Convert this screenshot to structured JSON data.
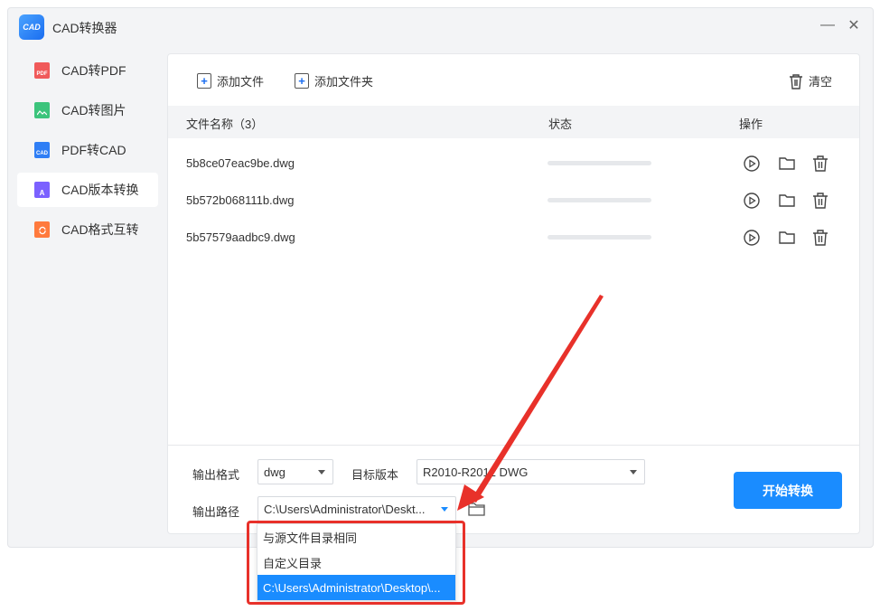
{
  "app": {
    "title": "CAD转换器",
    "logo_text": "CAD"
  },
  "window_controls": {
    "minimize": "—",
    "close": "✕"
  },
  "sidebar": {
    "items": [
      {
        "label": "CAD转PDF",
        "icon": "pdf-file-icon",
        "color": "#f05a5a",
        "tag": "PDF",
        "active": false
      },
      {
        "label": "CAD转图片",
        "icon": "image-file-icon",
        "color": "#3cc47c",
        "tag": "",
        "active": false
      },
      {
        "label": "PDF转CAD",
        "icon": "cad-file-icon",
        "color": "#2f7ef5",
        "tag": "CAD",
        "active": false
      },
      {
        "label": "CAD版本转换",
        "icon": "version-file-icon",
        "color": "#7b61ff",
        "tag": "A",
        "active": true
      },
      {
        "label": "CAD格式互转",
        "icon": "format-convert-icon",
        "color": "#ff7a3d",
        "tag": "",
        "active": false
      }
    ]
  },
  "toolbar": {
    "add_file": "添加文件",
    "add_folder": "添加文件夹",
    "clear": "清空"
  },
  "table": {
    "headers": {
      "name": "文件名称（3）",
      "status": "状态",
      "actions": "操作"
    },
    "rows": [
      {
        "name": "5b8ce07eac9be.dwg",
        "progress": 0
      },
      {
        "name": "5b572b068111b.dwg",
        "progress": 0
      },
      {
        "name": "5b57579aadbc9.dwg",
        "progress": 0
      }
    ]
  },
  "settings": {
    "format_label": "输出格式",
    "format_value": "dwg",
    "version_label": "目标版本",
    "version_value": "R2010-R2012 DWG",
    "path_label": "输出路径",
    "path_value": "C:\\Users\\Administrator\\Deskt..."
  },
  "start_button": "开始转换",
  "path_dropdown": {
    "options": [
      {
        "label": "与源文件目录相同",
        "selected": false
      },
      {
        "label": "自定义目录",
        "selected": false
      },
      {
        "label": "C:\\Users\\Administrator\\Desktop\\...",
        "selected": true
      }
    ]
  },
  "colors": {
    "accent": "#1a8cff",
    "annotation": "#e8312a"
  }
}
